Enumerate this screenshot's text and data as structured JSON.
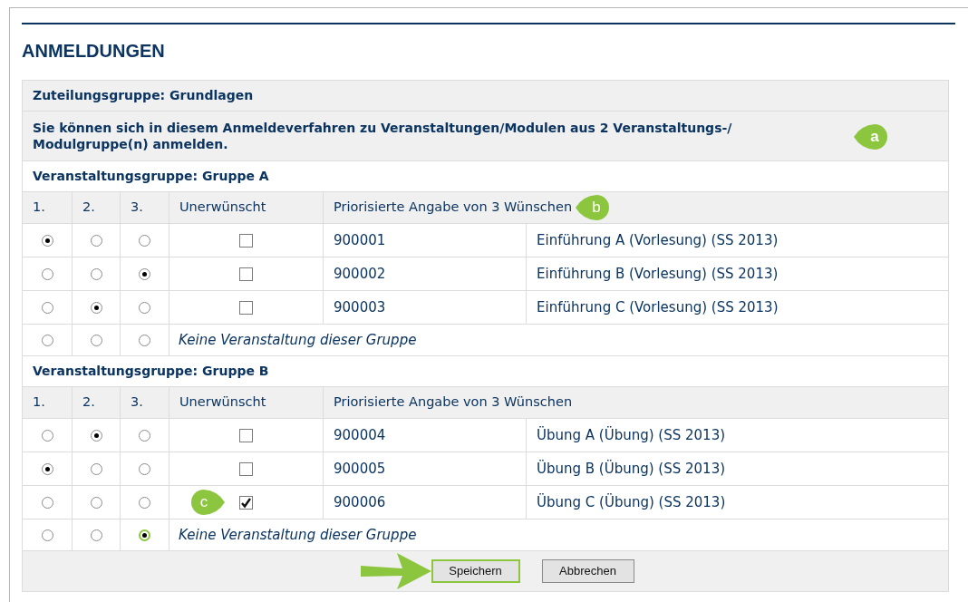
{
  "heading": "ANMELDUNGEN",
  "allocation_group": "Zuteilungsgruppe: Grundlagen",
  "notice": {
    "text": "Sie können sich in diesem Anmeldeverfahren zu Veranstaltungen/Modulen aus 2 Veranstaltungs-/ Modulgruppe(n) anmelden.",
    "callout": "a"
  },
  "groups": [
    {
      "title": "Veranstaltungsgruppe: Gruppe A",
      "columns": [
        "1.",
        "2.",
        "3.",
        "Unerwünscht",
        "Priorisierte Angabe von 3 Wünschen"
      ],
      "header_callout": "b",
      "rows": [
        {
          "kind": "course",
          "radios": [
            {
              "selected": true
            },
            {
              "selected": false
            },
            {
              "selected": false
            }
          ],
          "unwanted": false,
          "number": "900001",
          "title": "Einführung A (Vorlesung) (SS 2013)",
          "highlighted": false
        },
        {
          "kind": "course",
          "radios": [
            {
              "selected": false
            },
            {
              "selected": false
            },
            {
              "selected": true
            }
          ],
          "unwanted": false,
          "number": "900002",
          "title": "Einführung B (Vorlesung) (SS 2013)",
          "highlighted": false
        },
        {
          "kind": "course",
          "radios": [
            {
              "selected": false
            },
            {
              "selected": true
            },
            {
              "selected": false
            }
          ],
          "unwanted": false,
          "number": "900003",
          "title": "Einführung C (Vorlesung) (SS 2013)",
          "highlighted": false
        },
        {
          "kind": "none",
          "radios": [
            {
              "selected": false
            },
            {
              "selected": false
            },
            {
              "selected": false
            }
          ],
          "label": "Keine Veranstaltung dieser Gruppe",
          "highlighted": false
        }
      ]
    },
    {
      "title": "Veranstaltungsgruppe: Gruppe B",
      "columns": [
        "1.",
        "2.",
        "3.",
        "Unerwünscht",
        "Priorisierte Angabe von 3 Wünschen"
      ],
      "rows": [
        {
          "kind": "course",
          "radios": [
            {
              "selected": false
            },
            {
              "selected": true
            },
            {
              "selected": false
            }
          ],
          "unwanted": false,
          "number": "900004",
          "title": "Übung A (Übung) (SS 2013)",
          "highlighted": false
        },
        {
          "kind": "course",
          "radios": [
            {
              "selected": true
            },
            {
              "selected": false
            },
            {
              "selected": false
            }
          ],
          "unwanted": false,
          "number": "900005",
          "title": "Übung B (Übung) (SS 2013)",
          "highlighted": false
        },
        {
          "kind": "course",
          "radios": [
            {
              "selected": false
            },
            {
              "selected": false
            },
            {
              "selected": false
            }
          ],
          "unwanted": true,
          "number": "900006",
          "title": "Übung C (Übung) (SS 2013)",
          "highlighted": false,
          "callout": "c"
        },
        {
          "kind": "none",
          "radios": [
            {
              "selected": false
            },
            {
              "selected": false
            },
            {
              "selected": true
            }
          ],
          "label": "Keine Veranstaltung dieser Gruppe",
          "highlighted": true
        }
      ]
    }
  ],
  "buttons": [
    {
      "label": "Speichern",
      "highlighted": true
    },
    {
      "label": "Abbrechen",
      "highlighted": false
    }
  ]
}
